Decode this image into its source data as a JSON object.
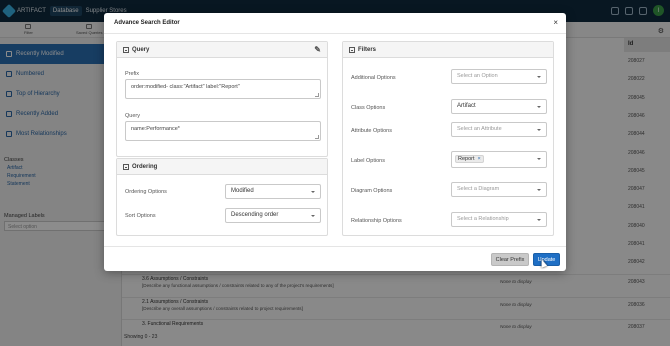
{
  "topbar": {
    "product": "ARTIFACT",
    "database_label": "Database",
    "context_text": "Supplier Stores"
  },
  "toolbar": {
    "filter_label": "Filter",
    "saved_queries_label": "Saved Queries"
  },
  "sidebar": {
    "items": [
      {
        "label": "Recently Modified",
        "icon": "clock-icon"
      },
      {
        "label": "Numbered",
        "icon": "numbered-list-icon"
      },
      {
        "label": "Top of Hierarchy",
        "icon": "hierarchy-icon"
      },
      {
        "label": "Recently Added",
        "icon": "plus-icon"
      },
      {
        "label": "Most Relationships",
        "icon": "link-icon"
      }
    ],
    "classes_heading": "Classes",
    "classes": [
      "Artifact",
      "Requirement",
      "Statement"
    ],
    "managed_labels_heading": "Managed Labels",
    "managed_labels_placeholder": "Select option"
  },
  "grid": {
    "id_header": "Id",
    "ids": [
      "208027",
      "208022",
      "208045",
      "208046",
      "208044",
      "208046",
      "208045",
      "208047",
      "208041",
      "208040",
      "208041",
      "208042"
    ],
    "rows": [
      {
        "title": "3.6 Assumptions / Constraints",
        "desc": "[Describe any functional assumptions / constraints related to any of the project's requirements]",
        "status": "None to display",
        "id": "208043"
      },
      {
        "title": "2.1 Assumptions / Constraints",
        "desc": "[Describe any overall assumptions / constraints related to project requirements]",
        "status": "None to display",
        "id": "208036"
      },
      {
        "title": "3. Functional Requirements",
        "desc": "",
        "status": "None to display",
        "id": "208037"
      }
    ],
    "showing_text": "Showing 0 - 23"
  },
  "modal": {
    "title": "Advance Search Editor",
    "close": "×",
    "query_panel": {
      "heading": "Query",
      "prefix_label": "Prefix",
      "prefix_value": "order:modified- class:\"Artifact\" label:\"Report\"",
      "query_label": "Query",
      "query_value": "name:Performance*"
    },
    "ordering_panel": {
      "heading": "Ordering",
      "ordering_label": "Ordering Options",
      "ordering_value": "Modified",
      "sort_label": "Sort Options",
      "sort_value": "Descending order"
    },
    "filters_panel": {
      "heading": "Filters",
      "additional_label": "Additional Options",
      "additional_placeholder": "Select an Option",
      "class_label": "Class Options",
      "class_value": "Artifact",
      "attribute_label": "Attribute Options",
      "attribute_placeholder": "Select an Attribute",
      "label_label": "Label Options",
      "label_tag": "Report",
      "label_tag_remove": "×",
      "diagram_label": "Diagram Options",
      "diagram_placeholder": "Select a Diagram",
      "relationship_label": "Relationship Options",
      "relationship_placeholder": "Select a Relationship"
    },
    "footer": {
      "clear_label": "Clear Prefix",
      "update_label": "Update"
    }
  },
  "colors": {
    "topbar": "#0f2a3e",
    "sidebar_active": "#2a6fb3",
    "update_button": "#1f6fc5"
  }
}
